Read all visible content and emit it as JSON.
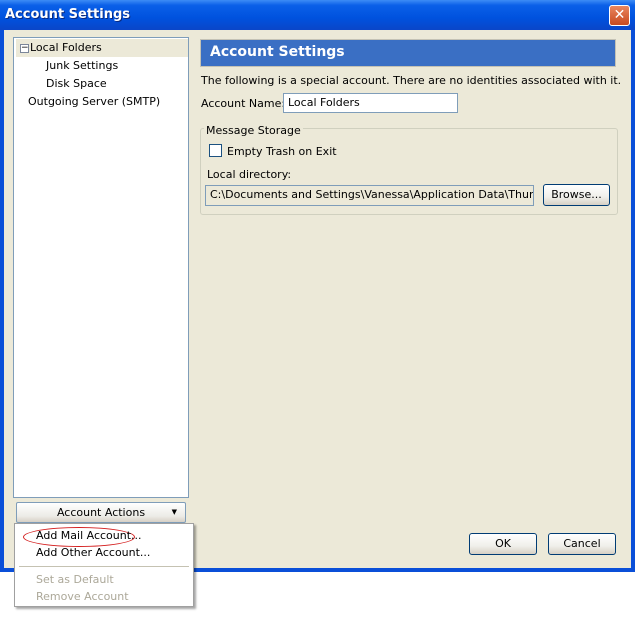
{
  "window": {
    "title": "Account Settings",
    "close_glyph": "✕"
  },
  "tree": {
    "items": [
      {
        "label": "Local Folders",
        "expander": "−"
      },
      {
        "label": "Junk Settings"
      },
      {
        "label": "Disk Space"
      },
      {
        "label": "Outgoing Server (SMTP)"
      }
    ]
  },
  "account_actions": {
    "label": "Account Actions",
    "arrow": "▼",
    "menu": [
      {
        "label": "Add Mail Account...",
        "enabled": true
      },
      {
        "label": "Add Other Account...",
        "enabled": true
      },
      {
        "label": "Set as Default",
        "enabled": false
      },
      {
        "label": "Remove Account",
        "enabled": false
      }
    ]
  },
  "panel": {
    "header": "Account Settings",
    "notice": "The following is a special account. There are no identities associated with it.",
    "account_name_label": "Account Name:",
    "account_name_value": "Local Folders",
    "storage_legend": "Message Storage",
    "empty_trash_label": "Empty Trash on Exit",
    "empty_trash_checked": false,
    "local_dir_label": "Local directory:",
    "local_dir_value": "C:\\Documents and Settings\\Vanessa\\Application Data\\Thunderbird",
    "browse_label": "Browse..."
  },
  "buttons": {
    "ok": "OK",
    "cancel": "Cancel"
  },
  "colors": {
    "title_bar": "#0052de",
    "header_bar": "#3a6fc4",
    "dialog_bg": "#ece9d8",
    "highlight_oval": "#d41f1f"
  }
}
